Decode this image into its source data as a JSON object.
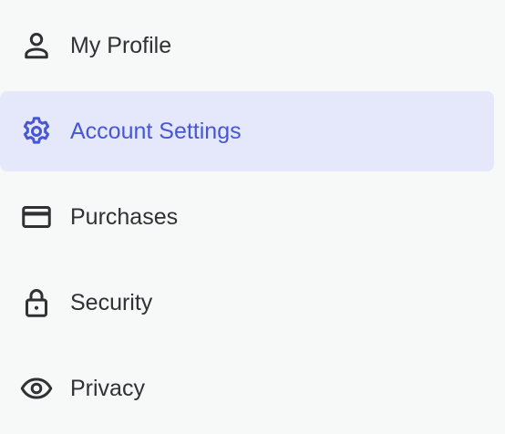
{
  "nav": {
    "active_color": "#4757d4",
    "active_background": "#e5e8fb",
    "text_color": "#2f3133",
    "items": [
      {
        "label": "My Profile",
        "icon": "user-icon",
        "active": false
      },
      {
        "label": "Account Settings",
        "icon": "gear-icon",
        "active": true
      },
      {
        "label": "Purchases",
        "icon": "credit-card-icon",
        "active": false
      },
      {
        "label": "Security",
        "icon": "lock-icon",
        "active": false
      },
      {
        "label": "Privacy",
        "icon": "eye-icon",
        "active": false
      }
    ]
  }
}
